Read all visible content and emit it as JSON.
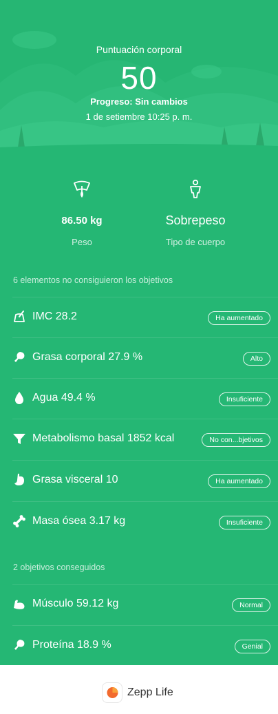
{
  "header": {
    "title": "Puntuación corporal",
    "score": "50",
    "progress": "Progreso: Sin cambios",
    "date": "1 de setiembre 10:25  p. m."
  },
  "stats": {
    "weight": {
      "value": "86.50 kg",
      "label": "Peso",
      "icon": "scale-icon"
    },
    "body_type": {
      "value": "Sobrepeso",
      "label": "Tipo de cuerpo",
      "icon": "body-type-icon"
    }
  },
  "unmet": {
    "label": "6 elementos no consiguieron los objetivos",
    "items": [
      {
        "text": "IMC 28.2",
        "badge": "Ha aumentado",
        "icon": "bmi-icon"
      },
      {
        "text": "Grasa corporal 27.9 %",
        "badge": "Alto",
        "icon": "body-fat-icon"
      },
      {
        "text": "Agua 49.4 %",
        "badge": "Insuficiente",
        "icon": "water-drop-icon"
      },
      {
        "text": "Metabolismo basal 1852 kcal",
        "badge": "No con...bjetivos",
        "icon": "metabolism-funnel-icon"
      },
      {
        "text": "Grasa visceral 10",
        "badge": "Ha aumentado",
        "icon": "stomach-icon"
      },
      {
        "text": "Masa ósea 3.17 kg",
        "badge": "Insuficiente",
        "icon": "bone-icon"
      }
    ]
  },
  "met": {
    "label": "2 objetivos conseguidos",
    "items": [
      {
        "text": "Músculo 59.12 kg",
        "badge": "Normal",
        "icon": "muscle-arm-icon"
      },
      {
        "text": "Proteína 18.9 %",
        "badge": "Genial",
        "icon": "protein-drumstick-icon"
      }
    ]
  },
  "footer": {
    "brand": "Zepp Life",
    "icon": "zepp-life-logo"
  },
  "colors": {
    "background": "#25b774",
    "header": "#26b673",
    "footer": "#ffffff",
    "logo_orange": "#f26a2e"
  }
}
